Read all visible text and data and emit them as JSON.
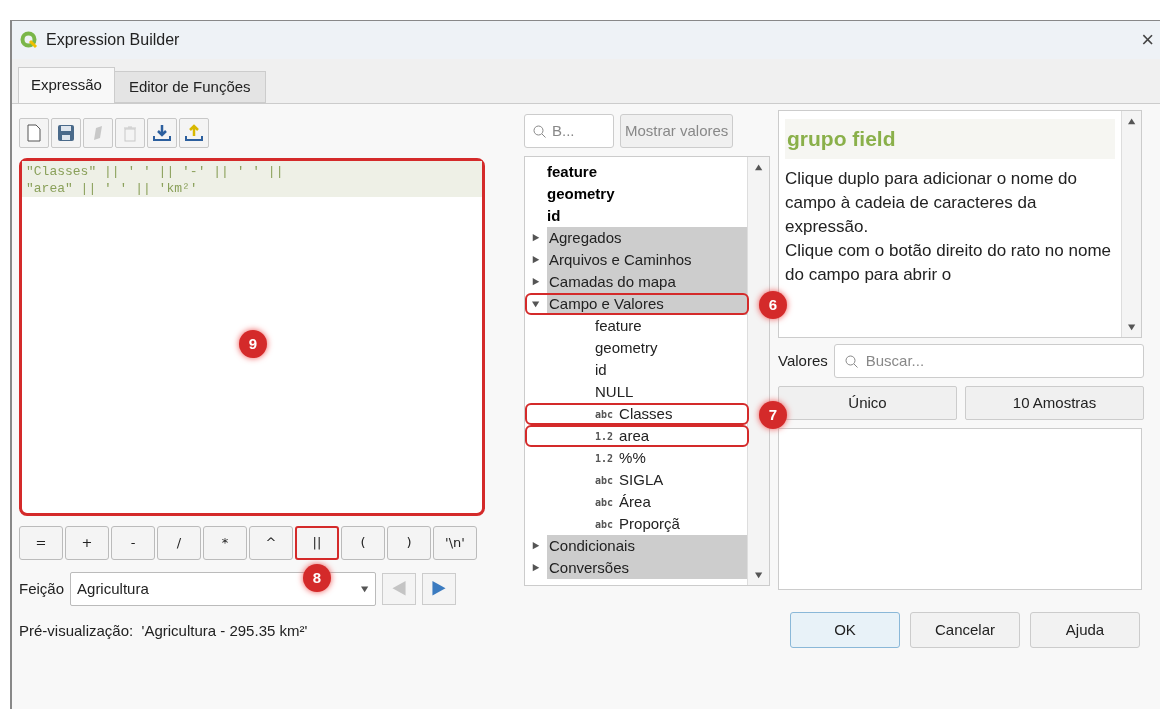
{
  "window": {
    "title": "Expression Builder",
    "close": "×"
  },
  "tabs": [
    {
      "label": "Expressão",
      "selected": true
    },
    {
      "label": "Editor de Funções",
      "selected": false
    }
  ],
  "toolbar": [
    {
      "kind": "new",
      "disabled": false
    },
    {
      "kind": "save",
      "disabled": false
    },
    {
      "kind": "edit",
      "disabled": true
    },
    {
      "kind": "delete",
      "disabled": true
    },
    {
      "kind": "import",
      "disabled": false
    },
    {
      "kind": "export",
      "disabled": false
    }
  ],
  "editor": {
    "lines": [
      "\"Classes\" || ' ' || '-' || ' ' ||",
      "\"area\" || ' ' || 'km²'"
    ],
    "callout": "9"
  },
  "operators": [
    {
      "label": "="
    },
    {
      "label": "+"
    },
    {
      "label": "-"
    },
    {
      "label": "/"
    },
    {
      "label": "*"
    },
    {
      "label": "^"
    },
    {
      "label": "||",
      "callout": "8"
    },
    {
      "label": "("
    },
    {
      "label": ")"
    },
    {
      "label": "'\\n'"
    }
  ],
  "feature_picker": {
    "label": "Feição",
    "value": "Agricultura",
    "prev_disabled": true,
    "next_disabled": false
  },
  "preview": "Pré-visualização:  'Agricultura - 295.35 km²'",
  "search": {
    "placeholder": "B..."
  },
  "show_values_button": {
    "label": "Mostrar valores",
    "disabled": true
  },
  "tree": [
    {
      "kind": "variable",
      "label": "feature"
    },
    {
      "kind": "variable",
      "label": "geometry"
    },
    {
      "kind": "variable",
      "label": "id"
    },
    {
      "kind": "group",
      "label": "Agregados",
      "expanded": false
    },
    {
      "kind": "group",
      "label": "Arquivos e Caminhos",
      "expanded": false
    },
    {
      "kind": "group",
      "label": "Camadas do mapa",
      "expanded": false
    },
    {
      "kind": "group",
      "label": "Campo e Valores",
      "expanded": true,
      "callout": "6",
      "children": [
        {
          "kind": "value",
          "label": "feature"
        },
        {
          "kind": "value",
          "label": "geometry"
        },
        {
          "kind": "value",
          "label": "id"
        },
        {
          "kind": "value",
          "label": "NULL"
        },
        {
          "kind": "field",
          "type_tag": "abc",
          "label": "Classes",
          "callout": "7"
        },
        {
          "kind": "field",
          "type_tag": "1.2",
          "label": "area",
          "outlined": true
        },
        {
          "kind": "field",
          "type_tag": "1.2",
          "label": "%%"
        },
        {
          "kind": "field",
          "type_tag": "abc",
          "label": "SIGLA"
        },
        {
          "kind": "field",
          "type_tag": "abc",
          "label": "Área"
        },
        {
          "kind": "field",
          "type_tag": "abc",
          "label": "Proporçã"
        }
      ]
    },
    {
      "kind": "group",
      "label": "Condicionais",
      "expanded": false
    },
    {
      "kind": "group",
      "label": "Conversões",
      "expanded": false
    }
  ],
  "help": {
    "title": "grupo field",
    "body": "Clique duplo para adicionar o nome do campo à cadeia de caracteres da expressão.\nClique com o botão direito do rato no nome do campo para abrir o"
  },
  "values": {
    "label": "Valores",
    "placeholder": "Buscar...",
    "buttons": [
      "Único",
      "10 Amostras"
    ]
  },
  "dialog_buttons": [
    {
      "label": "OK",
      "default": true
    },
    {
      "label": "Cancelar",
      "default": false
    },
    {
      "label": "Ajuda",
      "default": false
    }
  ]
}
